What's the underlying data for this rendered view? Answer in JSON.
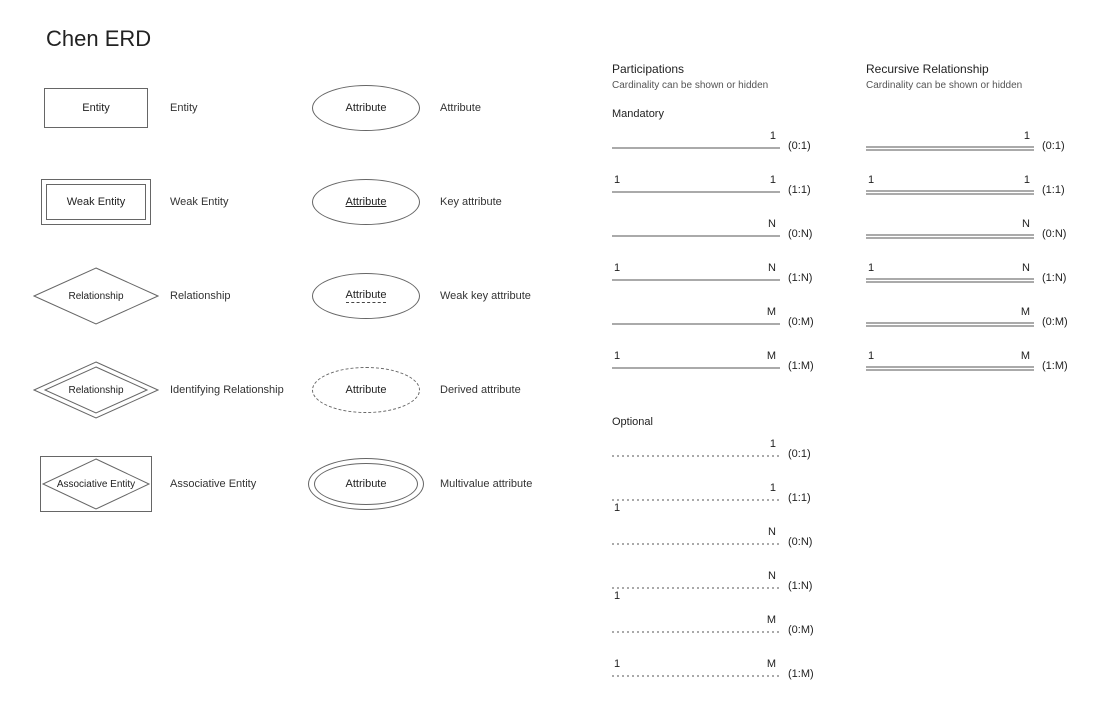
{
  "title": "Chen ERD",
  "shapes_left": [
    {
      "name": "entity",
      "label": "Entity",
      "desc": "Entity"
    },
    {
      "name": "weak-entity",
      "label": "Weak Entity",
      "desc": "Weak Entity"
    },
    {
      "name": "relationship",
      "label": "Relationship",
      "desc": "Relationship"
    },
    {
      "name": "identifying-relationship",
      "label": "Relationship",
      "desc": "Identifying Relationship"
    },
    {
      "name": "associative-entity",
      "label": "Associative Entity",
      "desc": "Associative Entity"
    }
  ],
  "shapes_right": [
    {
      "name": "attribute",
      "label": "Attribute",
      "desc": "Attribute"
    },
    {
      "name": "key-attribute",
      "label": "Attribute",
      "desc": "Key attribute"
    },
    {
      "name": "weak-key-attribute",
      "label": "Attribute",
      "desc": "Weak key attribute"
    },
    {
      "name": "derived-attribute",
      "label": "Attribute",
      "desc": "Derived attribute"
    },
    {
      "name": "multivalue-attribute",
      "label": "Attribute",
      "desc": "Multivalue attribute"
    }
  ],
  "participations": {
    "heading": "Participations",
    "sub": "Cardinality can be shown or hidden",
    "mandatory_heading": "Mandatory",
    "optional_heading": "Optional",
    "mandatory": [
      {
        "left": "",
        "right": "1",
        "ratio": "(0:1)"
      },
      {
        "left": "1",
        "right": "1",
        "ratio": "(1:1)"
      },
      {
        "left": "",
        "right": "N",
        "ratio": "(0:N)"
      },
      {
        "left": "1",
        "right": "N",
        "ratio": "(1:N)"
      },
      {
        "left": "",
        "right": "M",
        "ratio": "(0:M)"
      },
      {
        "left": "1",
        "right": "M",
        "ratio": "(1:M)"
      }
    ],
    "optional": [
      {
        "left": "",
        "right": "1",
        "ratio": "(0:1)"
      },
      {
        "left": "1",
        "right": "1",
        "below": true,
        "ratio": "(1:1)"
      },
      {
        "left": "",
        "right": "N",
        "ratio": "(0:N)"
      },
      {
        "left": "1",
        "right": "N",
        "below": true,
        "ratio": "(1:N)"
      },
      {
        "left": "",
        "right": "M",
        "ratio": "(0:M)"
      },
      {
        "left": "1",
        "right": "M",
        "ratio": "(1:M)"
      }
    ]
  },
  "recursive": {
    "heading": "Recursive Relationship",
    "sub": "Cardinality can be shown or hidden",
    "rows": [
      {
        "left": "",
        "right": "1",
        "ratio": "(0:1)"
      },
      {
        "left": "1",
        "right": "1",
        "ratio": "(1:1)"
      },
      {
        "left": "",
        "right": "N",
        "ratio": "(0:N)"
      },
      {
        "left": "1",
        "right": "N",
        "ratio": "(1:N)"
      },
      {
        "left": "",
        "right": "M",
        "ratio": "(0:M)"
      },
      {
        "left": "1",
        "right": "M",
        "ratio": "(1:M)"
      }
    ]
  }
}
